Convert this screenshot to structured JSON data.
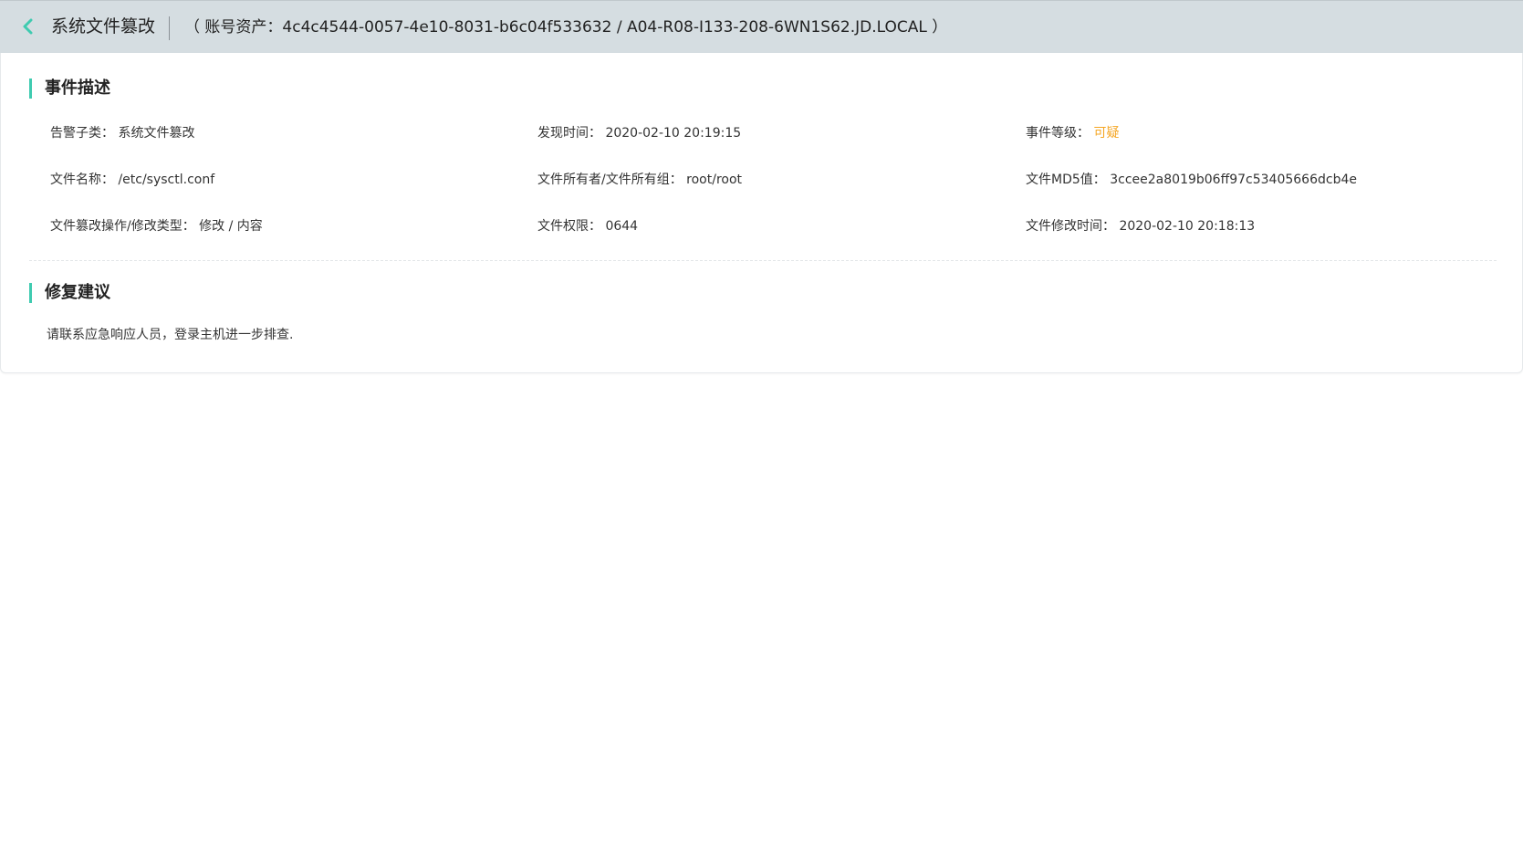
{
  "header": {
    "title": "系统文件篡改",
    "asset_prefix": "（ 账号资产：",
    "asset_id": "4c4c4544-0057-4e10-8031-b6c04f533632",
    "asset_separator": " / ",
    "asset_host": "A04-R08-I133-208-6WN1S62.JD.LOCAL",
    "asset_suffix": " ）"
  },
  "event": {
    "section_title": "事件描述",
    "fields": [
      {
        "label": "告警子类：",
        "value": "系统文件篡改"
      },
      {
        "label": "发现时间：",
        "value": "2020-02-10 20:19:15"
      },
      {
        "label": "事件等级：",
        "value": "可疑"
      },
      {
        "label": "文件名称：",
        "value": "/etc/sysctl.conf"
      },
      {
        "label": "文件所有者/文件所有组：",
        "value": "root/root"
      },
      {
        "label": "文件MD5值：",
        "value": "3ccee2a8019b06ff97c53405666dcb4e"
      },
      {
        "label": "文件篡改操作/修改类型：",
        "value": "修改 / 内容"
      },
      {
        "label": "文件权限：",
        "value": "0644"
      },
      {
        "label": "文件修改时间：",
        "value": "2020-02-10 20:18:13"
      }
    ]
  },
  "advice": {
    "section_title": "修复建议",
    "text": "请联系应急响应人员，登录主机进一步排查."
  },
  "colors": {
    "accent": "#3fcbb0",
    "header_bg": "#d5dde1",
    "level_warn": "#f5a623"
  },
  "icons": {
    "back": "chevron-left-icon"
  }
}
